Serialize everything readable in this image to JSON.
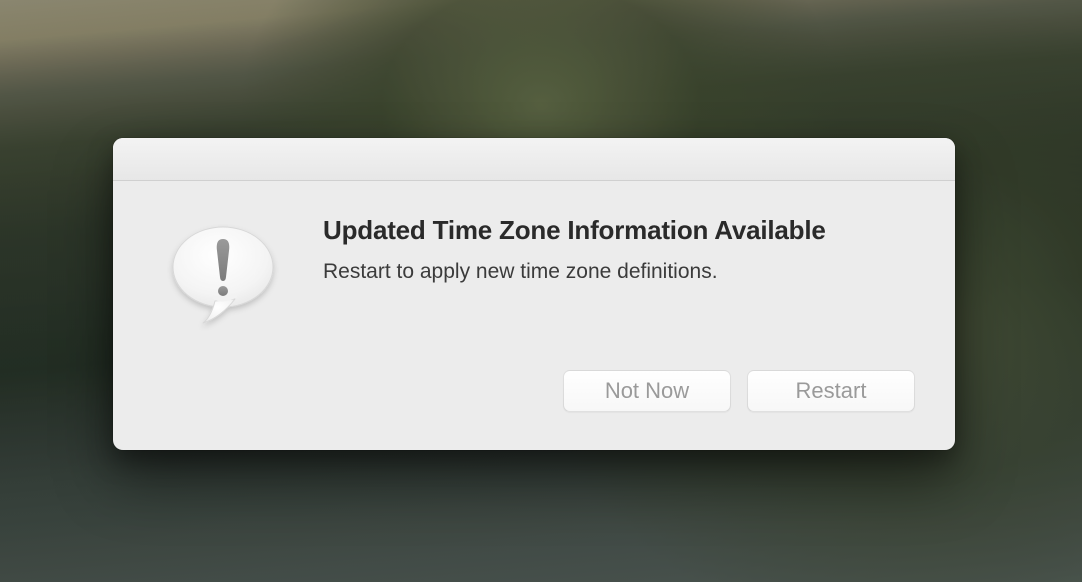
{
  "dialog": {
    "title": "Updated Time Zone Information Available",
    "message": "Restart to apply new time zone definitions.",
    "buttons": {
      "cancel": "Not Now",
      "confirm": "Restart"
    },
    "icon": "alert-speech-bubble"
  }
}
